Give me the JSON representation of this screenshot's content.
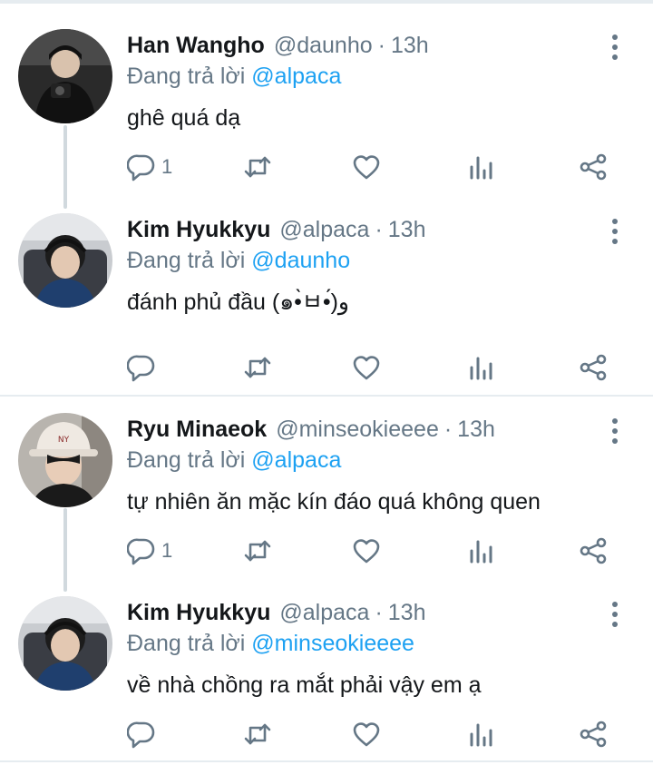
{
  "colors": {
    "accent": "#1da1f2",
    "muted": "#657786",
    "text": "#14171a",
    "divider": "#e6ecf0"
  },
  "tweets": [
    {
      "name": "Han Wangho",
      "handle": "@daunho",
      "sep": "·",
      "time": "13h",
      "reply_prefix": "Đang trả lời",
      "reply_to": "@alpaca",
      "text": "ghê quá dạ",
      "reply_count": "1",
      "icons": [
        "reply-icon",
        "retweet-icon",
        "like-icon",
        "analytics-icon",
        "share-icon",
        "more-icon"
      ]
    },
    {
      "name": "Kim Hyukkyu",
      "handle": "@alpaca",
      "sep": "·",
      "time": "13h",
      "reply_prefix": "Đang trả lời",
      "reply_to": "@daunho",
      "text": "đánh phủ đầu (๑•̀ㅂ•́)و",
      "reply_count": "",
      "icons": [
        "reply-icon",
        "retweet-icon",
        "like-icon",
        "analytics-icon",
        "share-icon",
        "more-icon"
      ]
    },
    {
      "name": "Ryu Minaeok",
      "handle": "@minseokieeee",
      "sep": "·",
      "time": "13h",
      "reply_prefix": "Đang trả lời",
      "reply_to": "@alpaca",
      "text": "tự nhiên ăn mặc kín đáo quá không quen",
      "reply_count": "1",
      "icons": [
        "reply-icon",
        "retweet-icon",
        "like-icon",
        "analytics-icon",
        "share-icon",
        "more-icon"
      ]
    },
    {
      "name": "Kim Hyukkyu",
      "handle": "@alpaca",
      "sep": "·",
      "time": "13h",
      "reply_prefix": "Đang trả lời",
      "reply_to": "@minseokieeee",
      "text": "về nhà chồng ra mắt phải vậy em ạ",
      "reply_count": "",
      "icons": [
        "reply-icon",
        "retweet-icon",
        "like-icon",
        "analytics-icon",
        "share-icon",
        "more-icon"
      ]
    }
  ]
}
